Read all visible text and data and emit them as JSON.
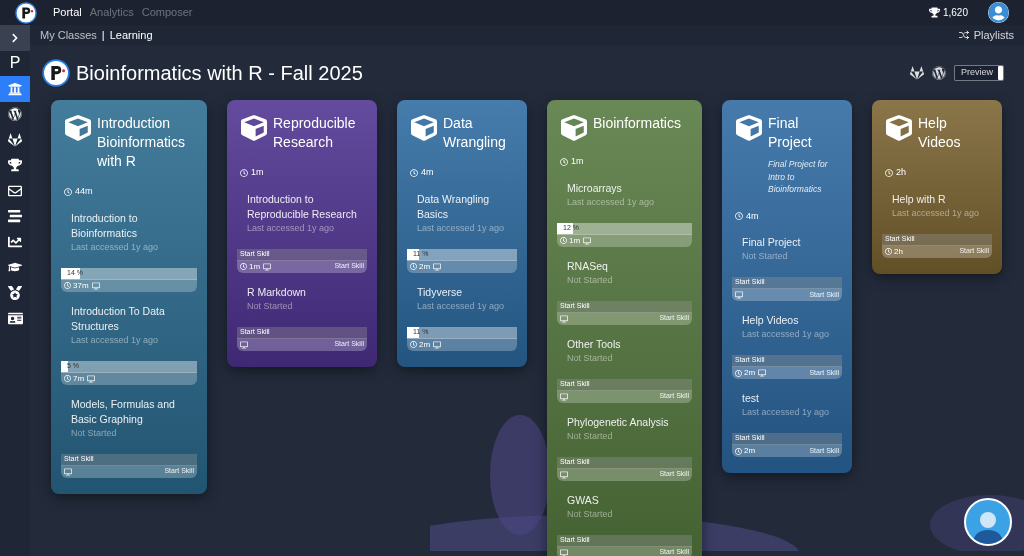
{
  "top_bar": {
    "nav": [
      {
        "label": "Portal",
        "selected": true
      },
      {
        "label": "Analytics",
        "selected": false
      },
      {
        "label": "Composer",
        "selected": false
      }
    ],
    "points": "1,620"
  },
  "breadcrumb": {
    "items": [
      "My Classes",
      "Learning"
    ],
    "separator": "|"
  },
  "playlists": "Playlists",
  "sidebar": {
    "items": [
      {
        "kind": "expand",
        "selected": false
      },
      {
        "kind": "letter",
        "label": "P",
        "selected": false
      },
      {
        "kind": "building",
        "selected": true
      },
      {
        "kind": "wordpress",
        "selected": false
      },
      {
        "kind": "gitlab",
        "selected": false
      },
      {
        "kind": "trophy",
        "selected": false
      },
      {
        "kind": "mail",
        "selected": false
      },
      {
        "kind": "list",
        "selected": false
      },
      {
        "kind": "chart",
        "selected": false
      },
      {
        "kind": "cap",
        "selected": false
      },
      {
        "kind": "medal",
        "selected": false
      },
      {
        "kind": "card",
        "selected": false
      }
    ]
  },
  "page_title": "Bioinformatics with R - Fall 2025",
  "preview": {
    "label": "Preview",
    "on": false
  },
  "modules": [
    {
      "title": "Introduction Bioinformatics with R",
      "color": "#2a6a8e",
      "duration": "44m",
      "skills": [
        {
          "title": "Introduction to Bioinformatics",
          "status": "Last accessed 1y ago",
          "footer": {
            "kind": "progress",
            "level": 0.14,
            "percent": "14 %",
            "time": "37m",
            "screen": true
          }
        },
        {
          "title": "Introduction To Data Structures",
          "status": "Last accessed 1y ago",
          "footer": {
            "kind": "progress",
            "level": 0.05,
            "percent": "5 %",
            "time": "7m",
            "screen": true
          }
        },
        {
          "title": "Models, Formulas and Basic Graphing",
          "status": "Not Started",
          "footer": {
            "kind": "start",
            "label": "Start Skill",
            "action": "Start Skill",
            "screen": true
          }
        }
      ]
    },
    {
      "title": "Reproducible Research",
      "color": "#4e3290",
      "duration": "1m",
      "skills": [
        {
          "title": "Introduction to Reproducible Research",
          "status": "Last accessed 1y ago",
          "footer": {
            "kind": "start",
            "label": "Start Skill",
            "action": "Start Skill",
            "time": "1m",
            "screen": true
          }
        },
        {
          "title": "R Markdown",
          "status": "Not Started",
          "footer": {
            "kind": "start",
            "label": "Start Skill",
            "action": "Start Skill",
            "screen": true
          }
        }
      ]
    },
    {
      "title": "Data Wrangling",
      "color": "#2c6aa0",
      "duration": "4m",
      "skills": [
        {
          "title": "Data Wrangling Basics",
          "status": "Last accessed 1y ago",
          "footer": {
            "kind": "progress",
            "level": 0.11,
            "percent": "11 %",
            "time": "2m",
            "screen": true
          }
        },
        {
          "title": "Tidyverse",
          "status": "Last accessed 1y ago",
          "footer": {
            "kind": "progress",
            "level": 0.11,
            "percent": "11 %",
            "time": "2m",
            "screen": true
          }
        }
      ]
    },
    {
      "title": "Bioinformatics",
      "color": "#54783e",
      "duration": "1m",
      "skills": [
        {
          "title": "Microarrays",
          "status": "Last accessed 1y ago",
          "footer": {
            "kind": "progress",
            "level": 0.12,
            "percent": "12 %",
            "time": "1m",
            "screen": true
          }
        },
        {
          "title": "RNASeq",
          "status": "Not Started",
          "footer": {
            "kind": "start",
            "label": "Start Skill",
            "action": "Start Skill",
            "screen": true
          }
        },
        {
          "title": "Other Tools",
          "status": "Not Started",
          "footer": {
            "kind": "start",
            "label": "Start Skill",
            "action": "Start Skill",
            "screen": true
          }
        },
        {
          "title": "Phylogenetic Analysis",
          "status": "Not Started",
          "footer": {
            "kind": "start",
            "label": "Start Skill",
            "action": "Start Skill",
            "screen": true
          }
        },
        {
          "title": "GWAS",
          "status": "Not Started",
          "footer": {
            "kind": "start",
            "label": "Start Skill",
            "action": "Start Skill",
            "screen": true
          }
        }
      ]
    },
    {
      "title": "Final Project",
      "color": "#2c68a0",
      "description": "Final Project for Intro to Bioinformatics",
      "duration": "4m",
      "skills": [
        {
          "title": "Final Project",
          "status": "Not Started",
          "footer": {
            "kind": "start",
            "label": "Start Skill",
            "action": "Start Skill",
            "screen": true
          }
        },
        {
          "title": "Help Videos",
          "status": "Last accessed 1y ago",
          "footer": {
            "kind": "start",
            "label": "Start Skill",
            "action": "Start Skill",
            "time": "2m",
            "screen": true
          }
        },
        {
          "title": "test",
          "status": "Last accessed 1y ago",
          "footer": {
            "kind": "start",
            "label": "Start Skill",
            "action": "Start Skill",
            "time": "2m",
            "screen": false
          }
        }
      ]
    },
    {
      "title": "Help Videos",
      "color": "#7a6330",
      "duration": "2h",
      "skills": [
        {
          "title": "Help with R",
          "status": "Last accessed 1y ago",
          "footer": {
            "kind": "start",
            "label": "Start Skill",
            "action": "Start Skill",
            "time": "2h",
            "screen": false
          }
        }
      ]
    }
  ]
}
